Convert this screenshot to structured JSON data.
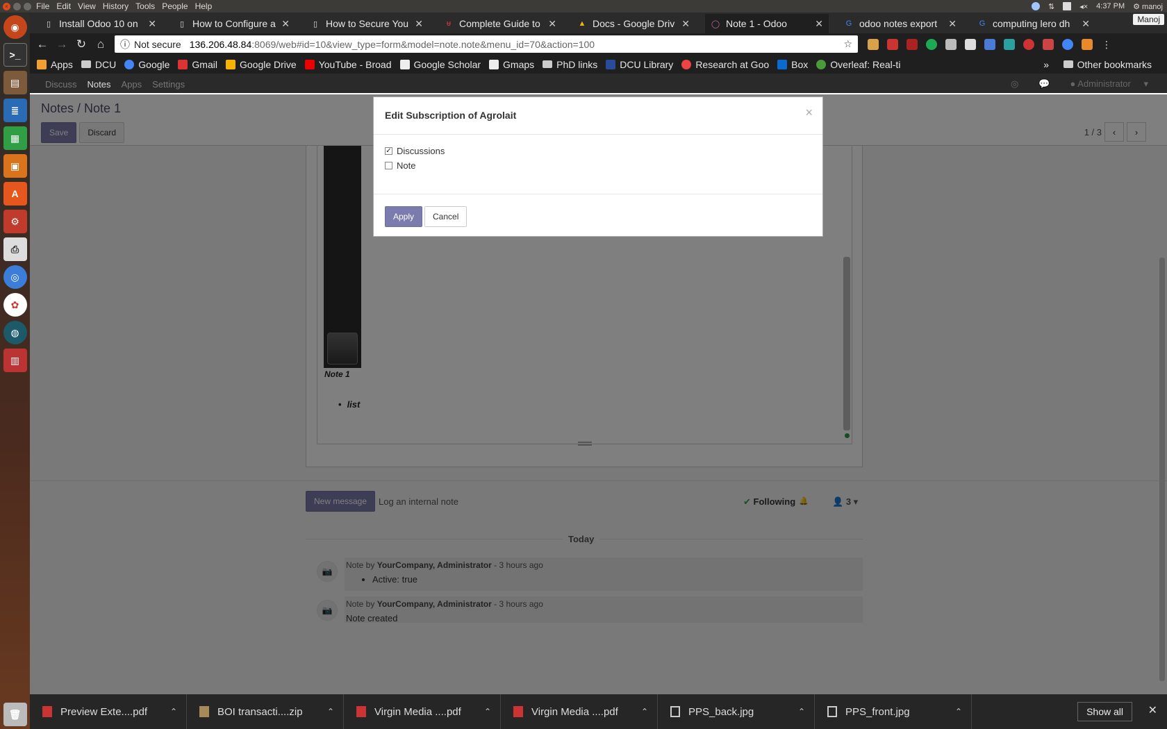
{
  "top_panel": {
    "menus": [
      "File",
      "Edit",
      "View",
      "History",
      "Tools",
      "People",
      "Help"
    ],
    "time": "4:37 PM",
    "user": "manoj"
  },
  "browser": {
    "tabs": [
      {
        "label": "Install Odoo 10 on",
        "icon": "page-icon"
      },
      {
        "label": "How to Configure a",
        "icon": "page-icon"
      },
      {
        "label": "How to Secure You",
        "icon": "page-icon"
      },
      {
        "label": "Complete Guide to",
        "icon": "brand-icon"
      },
      {
        "label": "Docs - Google Driv",
        "icon": "drive-icon"
      },
      {
        "label": "Note 1 - Odoo",
        "icon": "odoo-icon",
        "active": true
      },
      {
        "label": "odoo notes export",
        "icon": "google-icon"
      },
      {
        "label": "computing lero dh",
        "icon": "google-icon"
      }
    ],
    "profile": "Manoj",
    "url_security": "Not secure",
    "url_host": "136.206.48.84",
    "url_path": ":8069/web#id=10&view_type=form&model=note.note&menu_id=70&action=100",
    "bookmarks": [
      "Apps",
      "DCU",
      "Google",
      "Gmail",
      "Google Drive",
      "YouTube - Broad",
      "Google Scholar",
      "Gmaps",
      "PhD links",
      "DCU Library",
      "Research at Goo",
      "Box",
      "Overleaf: Real-ti"
    ],
    "bookmarks_other": "Other bookmarks",
    "bookmarks_more": "»"
  },
  "odoo": {
    "nav": [
      "Discuss",
      "Notes",
      "Apps",
      "Settings"
    ],
    "nav_active": "Notes",
    "user": "Administrator",
    "breadcrumb_parent": "Notes",
    "breadcrumb_current": "Note 1",
    "save_label": "Save",
    "discard_label": "Discard",
    "pager": "1 / 3",
    "note_caption": "Note 1",
    "list_item": "list"
  },
  "chatter": {
    "new_message": "New message",
    "log_note": "Log an internal note",
    "following": "Following",
    "followers_count": "3",
    "separator": "Today",
    "messages": [
      {
        "prefix": "Note by",
        "author": "YourCompany, Administrator",
        "time": "- 3 hours ago",
        "body_list": "Active: true"
      },
      {
        "prefix": "Note by",
        "author": "YourCompany, Administrator",
        "time": "- 3 hours ago",
        "body": "Note created"
      }
    ]
  },
  "modal": {
    "title": "Edit Subscription of Agrolait",
    "close": "×",
    "options": [
      {
        "label": "Discussions",
        "checked": true
      },
      {
        "label": "Note",
        "checked": false
      }
    ],
    "apply_label": "Apply",
    "cancel_label": "Cancel"
  },
  "downloads": {
    "items": [
      "Preview Exte....pdf",
      "BOI transacti....zip",
      "Virgin Media ....pdf",
      "Virgin Media ....pdf",
      "PPS_back.jpg",
      "PPS_front.jpg"
    ],
    "show_all": "Show all"
  },
  "colors": {
    "odoo_primary": "#7c7bad",
    "active_tab": "#1f1f1f"
  }
}
